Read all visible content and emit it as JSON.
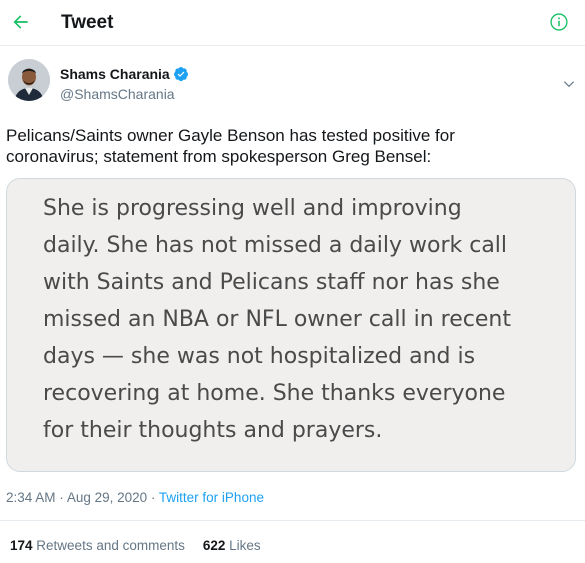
{
  "header": {
    "title": "Tweet"
  },
  "author": {
    "display_name": "Shams Charania",
    "handle": "@ShamsCharania",
    "verified": true
  },
  "tweet": {
    "text": "Pelicans/Saints owner Gayle Benson has tested positive for\ncoronavirus; statement from spokesperson Greg Bensel:",
    "image_text": "She is progressing well and improving\ndaily. She has not missed a daily work call\nwith Saints and Pelicans staff nor has she\nmissed an NBA or NFL owner call in recent\ndays — she was not hospitalized and is\nrecovering at home. She thanks everyone\nfor their thoughts and prayers."
  },
  "meta": {
    "time": "2:34 AM",
    "date": "Aug 29, 2020",
    "separator": "·",
    "source": "Twitter for iPhone"
  },
  "stats": {
    "retweets_count": "174",
    "retweets_label": "Retweets and comments",
    "likes_count": "622",
    "likes_label": "Likes"
  },
  "colors": {
    "accent": "#1da1f2",
    "accent_green": "#17bf63",
    "secondary_text": "#657786",
    "quote_background": "#f0efee"
  },
  "icons": {
    "back": "arrow-left-icon",
    "info": "info-icon",
    "verified": "verified-badge-icon",
    "caret": "chevron-down-icon"
  }
}
